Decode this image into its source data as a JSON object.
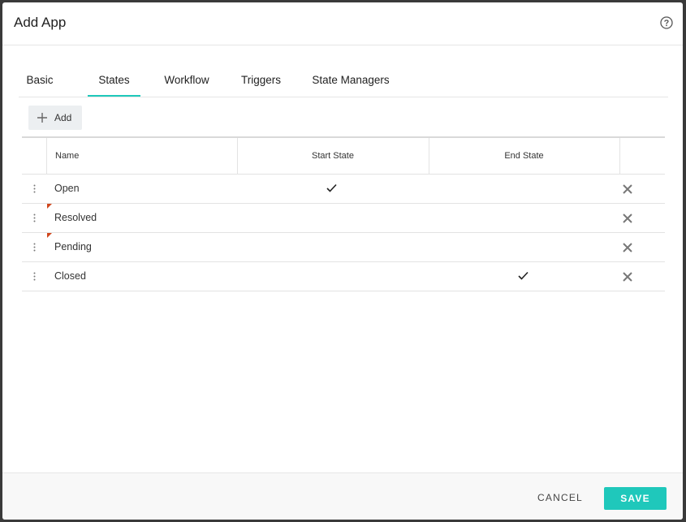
{
  "dialog": {
    "title": "Add App",
    "help_icon": "help-circle-icon"
  },
  "tabs": [
    {
      "label": "Basic",
      "active": false
    },
    {
      "label": "States",
      "active": true
    },
    {
      "label": "Workflow",
      "active": false
    },
    {
      "label": "Triggers",
      "active": false
    },
    {
      "label": "State Managers",
      "active": false
    }
  ],
  "toolbar": {
    "add_label": "Add",
    "add_icon": "plus-icon"
  },
  "grid": {
    "columns": {
      "name": "Name",
      "start_state": "Start State",
      "end_state": "End State"
    },
    "rows": [
      {
        "name": "Open",
        "start_state": true,
        "end_state": false,
        "flagged": false
      },
      {
        "name": "Resolved",
        "start_state": false,
        "end_state": false,
        "flagged": true
      },
      {
        "name": "Pending",
        "start_state": false,
        "end_state": false,
        "flagged": true
      },
      {
        "name": "Closed",
        "start_state": false,
        "end_state": true,
        "flagged": false
      }
    ]
  },
  "footer": {
    "cancel_label": "CANCEL",
    "save_label": "SAVE"
  },
  "colors": {
    "accent": "#1fc8bb",
    "flag": "#d0461c"
  }
}
